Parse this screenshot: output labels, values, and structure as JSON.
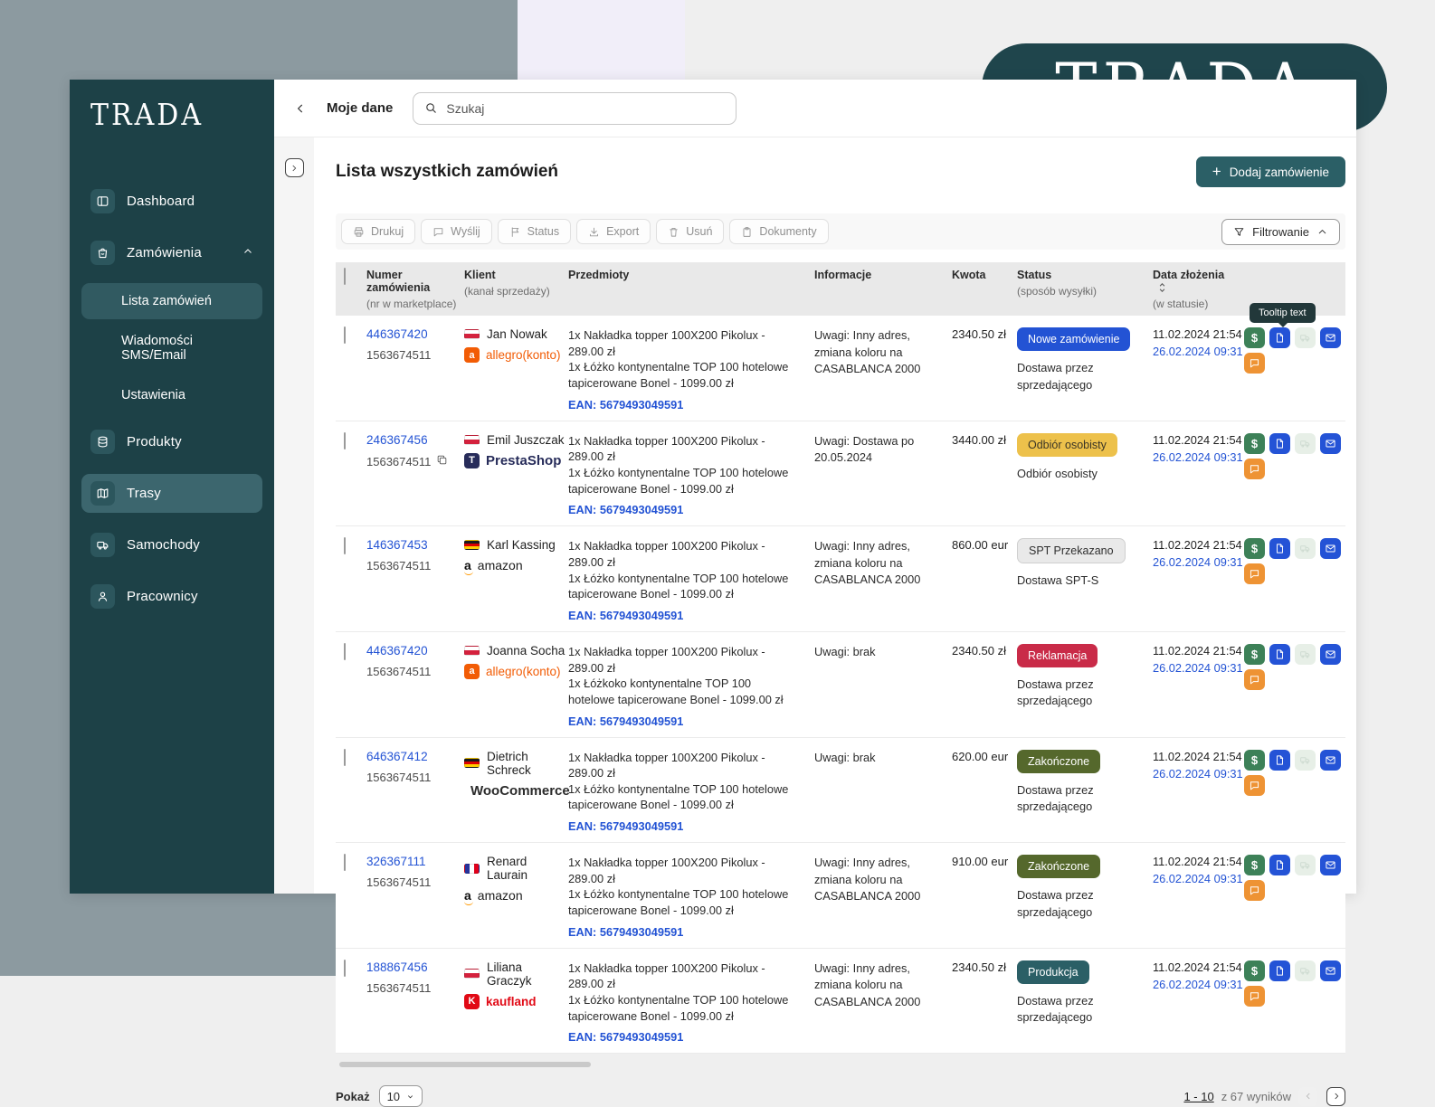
{
  "colors": {
    "sidebar-bg": "#1d4147",
    "sidebar-chip": "#2c565d",
    "sidebar-active": "#315a61",
    "sidebar-hover": "#3c666e",
    "brand-pill": "#1f454c",
    "accent-teal": "#2b5f66",
    "link-blue": "#2353d4",
    "icon-green": "#3d8158",
    "icon-blue": "#2453d6",
    "icon-orange": "#ee9334",
    "icon-disabled": "#e7efe7",
    "allegro-orange": "#f25c05",
    "prestashop-navy": "#272c5a",
    "kaufland-red": "#e10915",
    "tooltip-bg": "#22383a"
  },
  "brand": {
    "logo_text": "TRADA"
  },
  "sidebar": {
    "logo_text": "TRADA",
    "items": [
      {
        "label": "Dashboard"
      },
      {
        "label": "Zamówienia"
      },
      {
        "label": "Produkty"
      },
      {
        "label": "Trasy"
      },
      {
        "label": "Samochody"
      },
      {
        "label": "Pracownicy"
      }
    ],
    "submenu": [
      {
        "label": "Lista zamówień",
        "selected": true
      },
      {
        "label": "Wiadomości SMS/Email",
        "selected": false
      },
      {
        "label": "Ustawienia",
        "selected": false
      }
    ]
  },
  "topbar": {
    "back_label": "Moje dane",
    "search_placeholder": "Szukaj"
  },
  "page": {
    "title": "Lista wszystkich zamówień",
    "add_button_label": "Dodaj zamówienie",
    "add_button_plus": "+"
  },
  "toolbar": {
    "buttons": [
      "Drukuj",
      "Wyślij",
      "Status",
      "Export",
      "Usuń",
      "Dokumenty"
    ],
    "filter_label": "Filtrowanie"
  },
  "table": {
    "headers": {
      "order": {
        "title": "Numer zamówienia",
        "sub": "(nr w marketplace)"
      },
      "client": {
        "title": "Klient",
        "sub": "(kanał sprzedaży)"
      },
      "items": {
        "title": "Przedmioty"
      },
      "info": {
        "title": "Informacje"
      },
      "amount": {
        "title": "Kwota"
      },
      "status": {
        "title": "Status",
        "sub": "(sposób wysyłki)"
      },
      "date": {
        "title": "Data złożenia",
        "sub": "(w statusie)"
      }
    },
    "rows": [
      {
        "order_no": "446367420",
        "marketplace_no": "1563674511",
        "has_copy": false,
        "client": {
          "name": "Jan Nowak",
          "country": "pl",
          "channel": {
            "type": "allegro",
            "letter": "a",
            "label": "allegro(konto)"
          }
        },
        "items": [
          "1x Nakładka topper 100X200 Pikolux - 289.00 zł",
          "1x Łóżko kontynentalne TOP 100 hotelowe tapicerowane Bonel - 1099.00 zł"
        ],
        "ean": "EAN: 5679493049591",
        "info": "Uwagi: Inny adres, zmiana koloru na CASABLANCA 2000",
        "amount": "2340.50 zł",
        "status": {
          "label": "Nowe zamówienie",
          "bg": "#2353d4",
          "fg": "#ffffff"
        },
        "shipping": "Dostawa przez sprzedającego",
        "date1": "11.02.2024 21:54",
        "date2": "26.02.2024 09:31",
        "tooltip_text": "Tooltip text",
        "show_tooltip": true
      },
      {
        "order_no": "246367456",
        "marketplace_no": "1563674511",
        "has_copy": true,
        "client": {
          "name": "Emil Juszczak",
          "country": "pl",
          "channel": {
            "type": "prestashop",
            "letter": "T",
            "label": "PrestaShop"
          }
        },
        "items": [
          "1x Nakładka topper 100X200 Pikolux - 289.00 zł",
          "1x Łóżko kontynentalne TOP 100 hotelowe tapicerowane Bonel - 1099.00 zł"
        ],
        "ean": "EAN: 5679493049591",
        "info": "Uwagi: Dostawa po 20.05.2024",
        "amount": "3440.00 zł",
        "status": {
          "label": "Odbiór osobisty",
          "bg": "#edc14b",
          "fg": "#3a3526"
        },
        "shipping": "Odbiór osobisty",
        "date1": "11.02.2024 21:54",
        "date2": "26.02.2024 09:31",
        "show_tooltip": false
      },
      {
        "order_no": "146367453",
        "marketplace_no": "1563674511",
        "has_copy": false,
        "client": {
          "name": "Karl Kassing",
          "country": "de",
          "channel": {
            "type": "amazon",
            "letter": "a",
            "label": "amazon"
          }
        },
        "items": [
          "1x Nakładka topper 100X200 Pikolux - 289.00 zł",
          "1x Łóżko kontynentalne TOP 100 hotelowe tapicerowane Bonel - 1099.00 zł"
        ],
        "ean": "EAN: 5679493049591",
        "info": "Uwagi: Inny adres, zmiana koloru na CASABLANCA 2000",
        "amount": "860.00 eur",
        "status": {
          "label": "SPT Przekazano",
          "bg": "#e9e9e9",
          "fg": "#2f2f2f",
          "border": "#cfcfcf"
        },
        "shipping": "Dostawa SPT-S",
        "date1": "11.02.2024 21:54",
        "date2": "26.02.2024 09:31",
        "show_tooltip": false
      },
      {
        "order_no": "446367420",
        "marketplace_no": "1563674511",
        "has_copy": false,
        "client": {
          "name": "Joanna Socha",
          "country": "pl",
          "channel": {
            "type": "allegro",
            "letter": "a",
            "label": "allegro(konto)"
          }
        },
        "items": [
          "1x Nakładka topper 100X200 Pikolux - 289.00 zł",
          "1x Łóżkoko kontynentalne TOP 100 hotelowe tapicerowane Bonel - 1099.00 zł"
        ],
        "ean": "EAN: 5679493049591",
        "info": "Uwagi: brak",
        "amount": "2340.50 zł",
        "status": {
          "label": "Reklamacja",
          "bg": "#c92b48",
          "fg": "#ffffff"
        },
        "shipping": "Dostawa przez sprzedającego",
        "date1": "11.02.2024 21:54",
        "date2": "26.02.2024 09:31",
        "show_tooltip": false
      },
      {
        "order_no": "646367412",
        "marketplace_no": "1563674511",
        "has_copy": false,
        "client": {
          "name": "Dietrich Schreck",
          "country": "de",
          "channel": {
            "type": "woocommerce",
            "letter": "",
            "label": "WooCommerce"
          }
        },
        "items": [
          "1x Nakładka topper 100X200 Pikolux - 289.00 zł",
          "1x Łóżko kontynentalne TOP 100 hotelowe tapicerowane Bonel - 1099.00 zł"
        ],
        "ean": "EAN: 5679493049591",
        "info": "Uwagi: brak",
        "amount": "620.00 eur",
        "status": {
          "label": "Zakończone",
          "bg": "#55682c",
          "fg": "#ffffff"
        },
        "shipping": "Dostawa przez sprzedającego",
        "date1": "11.02.2024 21:54",
        "date2": "26.02.2024 09:31",
        "show_tooltip": false
      },
      {
        "order_no": "326367111",
        "marketplace_no": "1563674511",
        "has_copy": false,
        "client": {
          "name": "Renard Laurain",
          "country": "fr",
          "channel": {
            "type": "amazon",
            "letter": "a",
            "label": "amazon"
          }
        },
        "items": [
          "1x Nakładka topper 100X200 Pikolux - 289.00 zł",
          "1x Łóżko kontynentalne TOP 100 hotelowe tapicerowane Bonel - 1099.00 zł"
        ],
        "ean": "EAN: 5679493049591",
        "info": "Uwagi: Inny adres, zmiana koloru na CASABLANCA 2000",
        "amount": "910.00 eur",
        "status": {
          "label": "Zakończone",
          "bg": "#55682c",
          "fg": "#ffffff"
        },
        "shipping": "Dostawa przez sprzedającego",
        "date1": "11.02.2024 21:54",
        "date2": "26.02.2024 09:31",
        "show_tooltip": false
      },
      {
        "order_no": "188867456",
        "marketplace_no": "1563674511",
        "has_copy": false,
        "client": {
          "name": "Liliana Graczyk",
          "country": "pl",
          "channel": {
            "type": "kaufland",
            "letter": "K",
            "label": "kaufland"
          }
        },
        "items": [
          "1x Nakładka topper 100X200 Pikolux - 289.00 zł",
          "1x Łóżko kontynentalne TOP 100 hotelowe tapicerowane Bonel - 1099.00 zł"
        ],
        "ean": "EAN: 5679493049591",
        "info": "Uwagi: Inny adres, zmiana koloru na CASABLANCA 2000",
        "amount": "2340.50 zł",
        "status": {
          "label": "Produkcja",
          "bg": "#2b5f66",
          "fg": "#ffffff"
        },
        "shipping": "Dostawa przez sprzedającego",
        "date1": "11.02.2024 21:54",
        "date2": "26.02.2024 09:31",
        "show_tooltip": false
      }
    ]
  },
  "pagination": {
    "show_label": "Pokaż",
    "page_size": "10",
    "range": "1 - 10",
    "total_suffix": "z 67 wyników"
  }
}
